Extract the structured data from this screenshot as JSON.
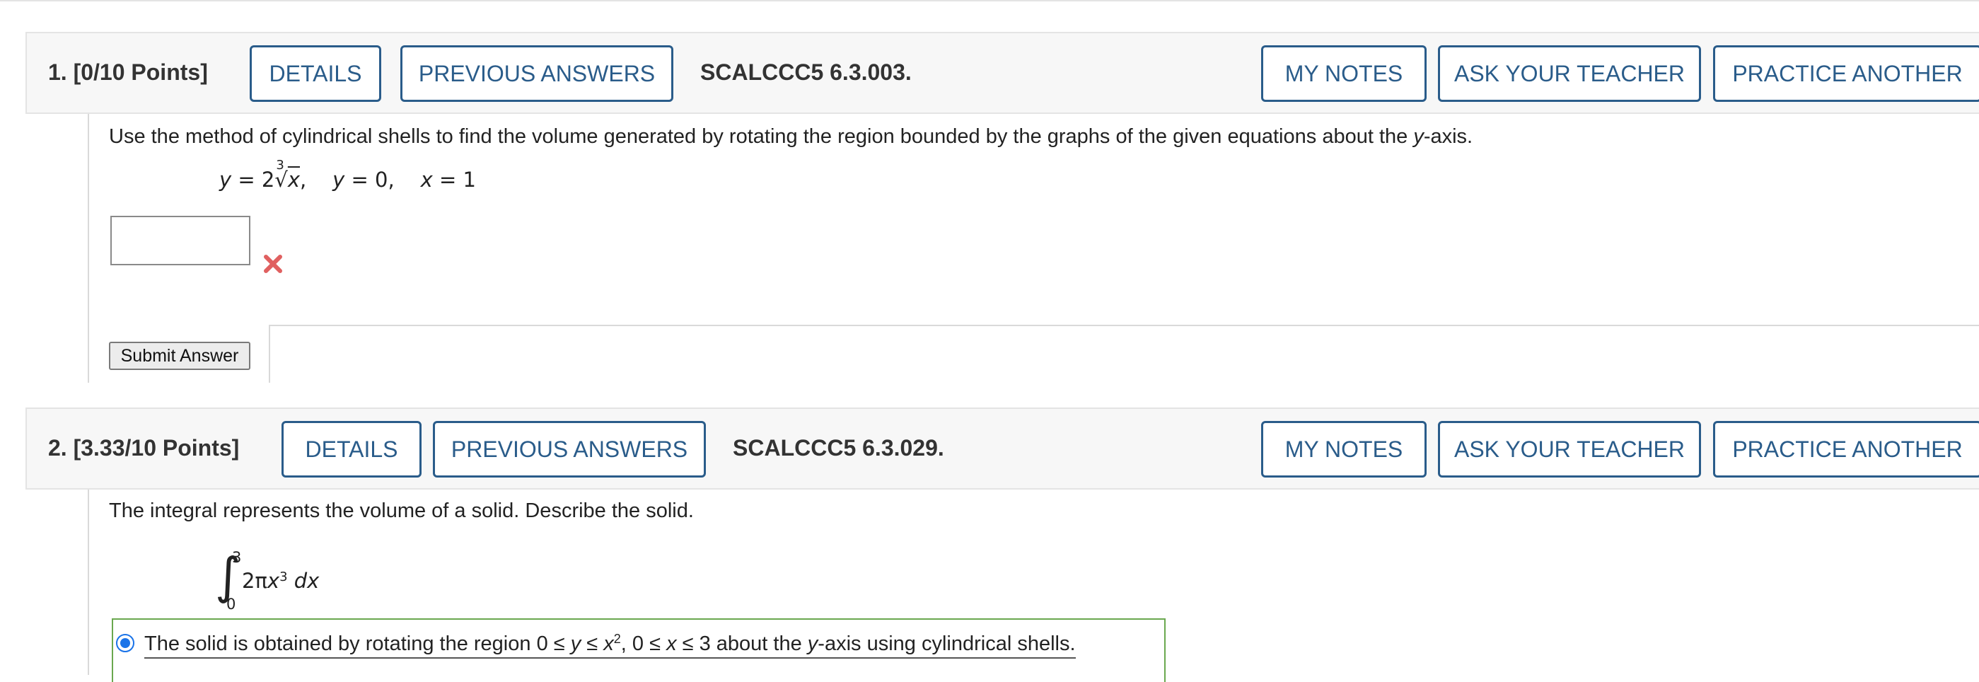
{
  "questions": [
    {
      "number_label": "1. [0/10 Points]",
      "details_label": "DETAILS",
      "previous_answers_label": "PREVIOUS ANSWERS",
      "code": "SCALCCC5 6.3.003.",
      "my_notes_label": "MY NOTES",
      "ask_teacher_label": "ASK YOUR TEACHER",
      "practice_label": "PRACTICE ANOTHER",
      "prompt_before": "Use the method of cylindrical shells to find the volume generated by rotating the region bounded by the graphs of the given equations about the ",
      "prompt_var": "y",
      "prompt_after": "-axis.",
      "eq_y1": "y",
      "eq_coef": " = 2",
      "eq_root_index": "3",
      "eq_radical": "√",
      "eq_radicand": "x",
      "eq_sep1": ",",
      "eq_y2": "y",
      "eq_part2": " = 0,",
      "eq_x3": "x",
      "eq_part3": " = 1",
      "answer_value": "",
      "answer_status": "incorrect",
      "submit_label": "Submit Answer"
    },
    {
      "number_label": "2. [3.33/10 Points]",
      "details_label": "DETAILS",
      "previous_answers_label": "PREVIOUS ANSWERS",
      "code": "SCALCCC5 6.3.029.",
      "my_notes_label": "MY NOTES",
      "ask_teacher_label": "ASK YOUR TEACHER",
      "practice_label": "PRACTICE ANOTHER",
      "prompt": "The integral represents the volume of a solid. Describe the solid.",
      "integral_sign": "∫",
      "integral_upper": "3",
      "integral_lower": "0",
      "integrand_coef": "2π",
      "integrand_var": "x",
      "integrand_exp": "3",
      "integrand_dx": " dx",
      "choice_part1": "The solid is obtained by rotating the region 0 ≤ ",
      "choice_y": "y",
      "choice_part2": " ≤ ",
      "choice_x": "x",
      "choice_exp": "2",
      "choice_part3": ", 0 ≤ ",
      "choice_x2": "x",
      "choice_part4": " ≤ 3 about the ",
      "choice_y2": "y",
      "choice_part5": "-axis using cylindrical shells.",
      "choice_selected": true
    }
  ],
  "colors": {
    "button_border": "#2a5c8a",
    "incorrect_mark": "#e06060",
    "selected_choice_border": "#6aa84f",
    "radio": "#1a73e8"
  },
  "icons": {
    "incorrect": "x-mark-icon",
    "radio": "radio-selected-icon"
  }
}
